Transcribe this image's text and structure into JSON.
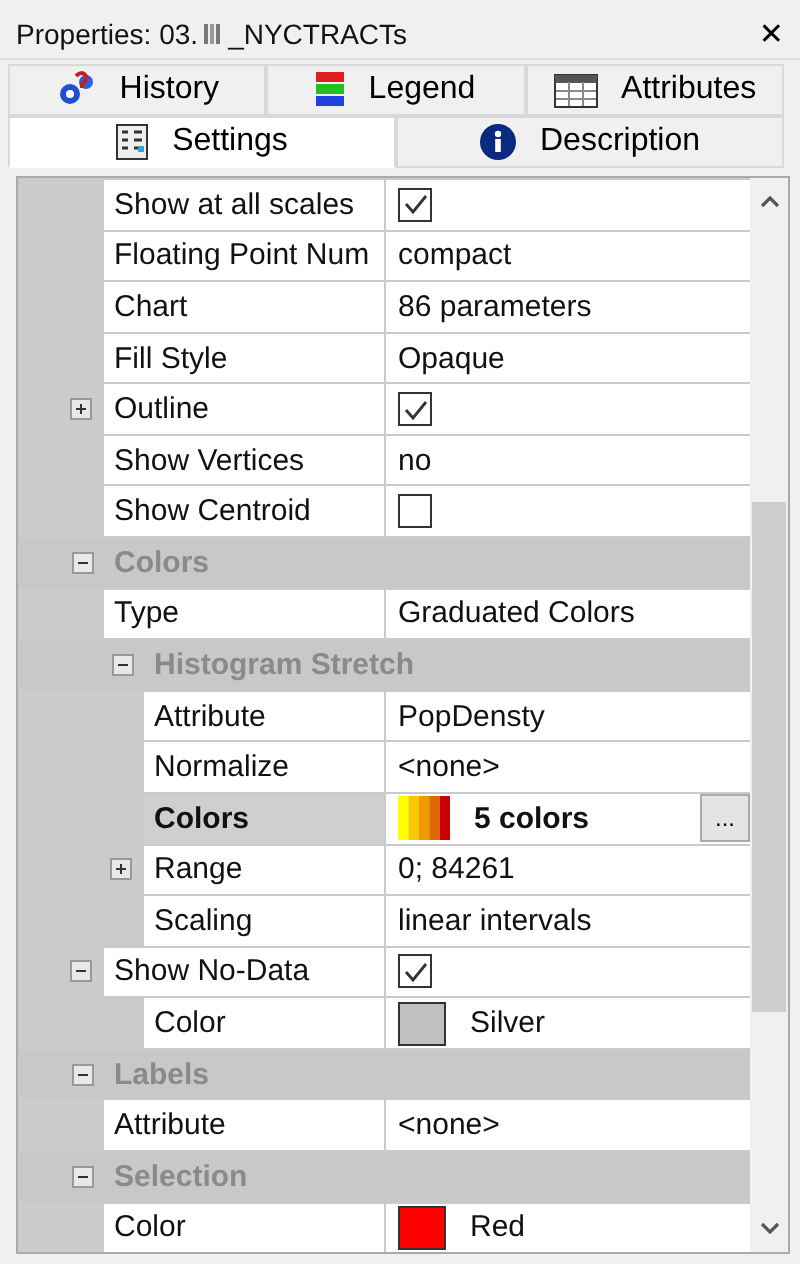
{
  "window": {
    "title_prefix": "Properties: 03.",
    "title_name": "_NYCTRACTs",
    "close": "✕"
  },
  "tab_rows": [
    [
      {
        "label": "History",
        "selected": false
      },
      {
        "label": "Legend",
        "selected": false
      },
      {
        "label": "Attributes",
        "selected": false
      }
    ],
    [
      {
        "label": "Settings",
        "selected": true
      },
      {
        "label": "Description",
        "selected": false
      }
    ]
  ],
  "grid": {
    "items": [
      {
        "kind": "checkbox",
        "label": "Show at all scales",
        "checked": true,
        "selected": false
      },
      {
        "kind": "text",
        "label": "Floating Point Num",
        "value": "compact",
        "selected": false
      },
      {
        "kind": "text",
        "label": "Chart",
        "value": "86 parameters",
        "selected": false
      },
      {
        "kind": "text",
        "label": "Fill Style",
        "value": "Opaque",
        "selected": false
      },
      {
        "kind": "checkbox",
        "label": "Outline",
        "checked": true,
        "selected": false,
        "expanded": false
      },
      {
        "kind": "text",
        "label": "Show Vertices",
        "value": "no",
        "selected": false
      },
      {
        "kind": "checkbox",
        "label": "Show Centroid",
        "checked": false,
        "selected": false
      },
      {
        "kind": "category",
        "label": "Colors",
        "expanded": true,
        "children": [
          {
            "kind": "text",
            "label": "Type",
            "value": "Graduated Colors",
            "selected": false
          },
          {
            "kind": "category",
            "label": "Histogram Stretch",
            "expanded": true,
            "children": [
              {
                "kind": "text",
                "label": "Attribute",
                "value": "PopDensty",
                "selected": false
              },
              {
                "kind": "text",
                "label": "Normalize",
                "value": "<none>",
                "selected": false
              },
              {
                "kind": "gradient",
                "label": "Colors",
                "colors": [
                  {
                    "color": "#ffff00"
                  },
                  {
                    "color": "#f8c800"
                  },
                  {
                    "color": "#f09a00"
                  },
                  {
                    "color": "#e06a00"
                  },
                  {
                    "color": "#c80000"
                  }
                ],
                "value": "5 colors",
                "button": "...",
                "selected": true
              },
              {
                "kind": "text",
                "label": "Range",
                "value": "0; 84261",
                "selected": false,
                "expanded": false
              },
              {
                "kind": "text",
                "label": "Scaling",
                "value": "linear intervals",
                "selected": false
              }
            ]
          },
          {
            "kind": "checkbox",
            "label": "Show No-Data",
            "checked": true,
            "selected": false,
            "expanded": true,
            "children": [
              {
                "kind": "swatch",
                "label": "Color",
                "color": "#c0c0c0",
                "value": "Silver",
                "selected": false
              }
            ]
          }
        ]
      },
      {
        "kind": "category",
        "label": "Labels",
        "expanded": true,
        "children": [
          {
            "kind": "text",
            "label": "Attribute",
            "value": "<none>",
            "selected": false
          }
        ]
      },
      {
        "kind": "category",
        "label": "Selection",
        "expanded": true,
        "children": [
          {
            "kind": "swatch",
            "label": "Color",
            "color": "#ff0000",
            "value": "Red",
            "selected": false
          }
        ]
      }
    ]
  }
}
